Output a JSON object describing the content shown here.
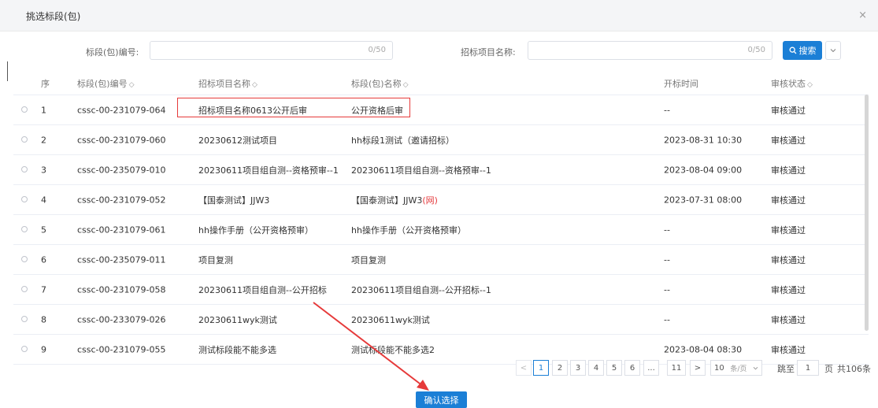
{
  "dialog": {
    "title": "挑选标段(包)",
    "close": "×"
  },
  "search": {
    "code_label": "标段(包)编号:",
    "code_value": "",
    "code_count": "0/50",
    "project_label": "招标项目名称:",
    "project_value": "",
    "project_count": "0/50",
    "search_button": "搜索",
    "search_icon": "search-icon",
    "more_icon": "chevron-down-icon"
  },
  "table": {
    "headers": {
      "seq": "序",
      "code": "标段(包)编号",
      "project": "招标项目名称",
      "name": "标段(包)名称",
      "open_time": "开标时间",
      "status": "审核状态",
      "sort_symbol": "◇"
    },
    "rows": [
      {
        "seq": "1",
        "code": "cssc-00-231079-064",
        "project": "招标项目名称0613公开后审",
        "name": "公开资格后审",
        "name_suffix": "",
        "open_time": "--",
        "status": "审核通过"
      },
      {
        "seq": "2",
        "code": "cssc-00-231079-060",
        "project": "20230612测试项目",
        "name": "hh标段1测试（邀请招标）",
        "name_suffix": "",
        "open_time": "2023-08-31 10:30",
        "status": "审核通过"
      },
      {
        "seq": "3",
        "code": "cssc-00-235079-010",
        "project": "20230611项目组自测--资格预审--1",
        "name": "20230611项目组自测--资格预审--1",
        "name_suffix": "",
        "open_time": "2023-08-04 09:00",
        "status": "审核通过"
      },
      {
        "seq": "4",
        "code": "cssc-00-231079-052",
        "project": "【国泰测试】JJW3",
        "name": "【国泰测试】JJW3",
        "name_suffix": "(网)",
        "open_time": "2023-07-31 08:00",
        "status": "审核通过"
      },
      {
        "seq": "5",
        "code": "cssc-00-231079-061",
        "project": "hh操作手册（公开资格预审）",
        "name": "hh操作手册（公开资格预审）",
        "name_suffix": "",
        "open_time": "--",
        "status": "审核通过"
      },
      {
        "seq": "6",
        "code": "cssc-00-235079-011",
        "project": "项目复测",
        "name": "项目复测",
        "name_suffix": "",
        "open_time": "--",
        "status": "审核通过"
      },
      {
        "seq": "7",
        "code": "cssc-00-231079-058",
        "project": "20230611项目组自测--公开招标",
        "name": "20230611项目组自测--公开招标--1",
        "name_suffix": "",
        "open_time": "--",
        "status": "审核通过"
      },
      {
        "seq": "8",
        "code": "cssc-00-233079-026",
        "project": "20230611wyk测试",
        "name": "20230611wyk测试",
        "name_suffix": "",
        "open_time": "--",
        "status": "审核通过"
      },
      {
        "seq": "9",
        "code": "cssc-00-231079-055",
        "project": "测试标段能不能多选",
        "name": "测试标段能不能多选2",
        "name_suffix": "",
        "open_time": "2023-08-04 08:30",
        "status": "审核通过"
      }
    ]
  },
  "pagination": {
    "prev": "<",
    "pages": [
      "1",
      "2",
      "3",
      "4",
      "5",
      "6",
      "...",
      "11"
    ],
    "current_page": "1",
    "next": ">",
    "page_size": "10",
    "page_size_unit": "条/页",
    "jump_label": "跳至",
    "jump_value": "1",
    "page_unit": "页",
    "total": "共106条"
  },
  "confirm_button": "确认选择",
  "colors": {
    "primary": "#1b7fd6",
    "highlight": "#e63a3a",
    "annotation_arrow": "#e63a3a"
  }
}
